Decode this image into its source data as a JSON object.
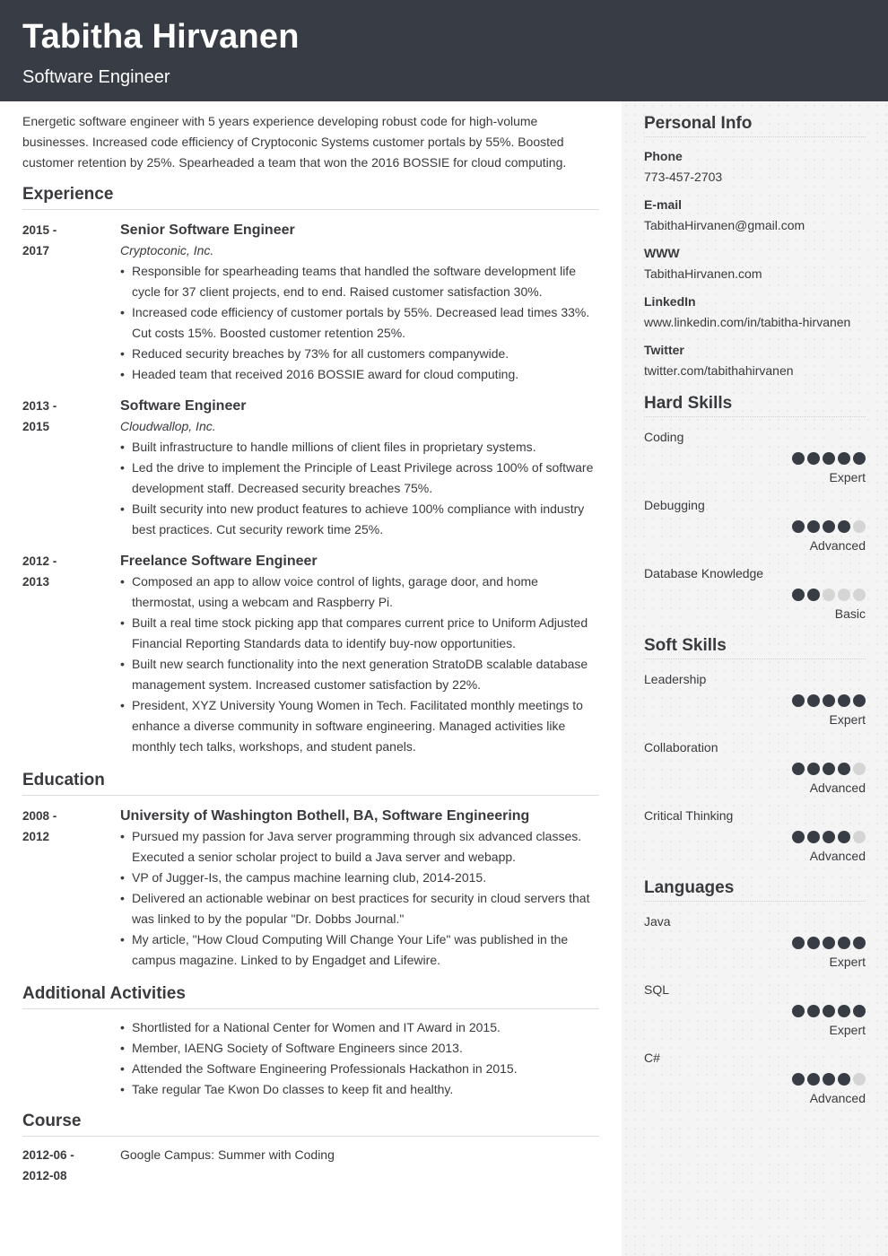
{
  "header": {
    "name": "Tabitha Hirvanen",
    "role": "Software Engineer"
  },
  "summary": "Energetic software engineer with 5 years experience developing robust code for high-volume businesses. Increased code efficiency of Cryptoconic Systems customer portals by 55%. Boosted customer retention by 25%. Spearheaded a team that won the 2016 BOSSIE for cloud computing.",
  "experience": {
    "heading": "Experience",
    "entries": [
      {
        "date_start": "2015 -",
        "date_end": "2017",
        "title": "Senior Software Engineer",
        "company": "Cryptoconic, Inc.",
        "bullets": [
          "Responsible for spearheading teams that handled the software development life cycle for 37 client projects, end to end. Raised customer satisfaction 30%.",
          "Increased code efficiency of customer portals by 55%. Decreased lead times 33%. Cut costs 15%. Boosted customer retention 25%.",
          "Reduced security breaches by 73% for all customers companywide.",
          "Headed team that received 2016 BOSSIE award for cloud computing."
        ]
      },
      {
        "date_start": "2013 -",
        "date_end": "2015",
        "title": "Software Engineer",
        "company": "Cloudwallop, Inc.",
        "bullets": [
          "Built infrastructure to handle millions of client files in proprietary systems.",
          "Led the drive to implement the Principle of Least Privilege across 100% of software development staff. Decreased security breaches 75%.",
          "Built security into new product features to achieve 100% compliance with industry best practices. Cut security rework time 25%."
        ]
      },
      {
        "date_start": "2012 -",
        "date_end": "2013",
        "title": "Freelance Software Engineer",
        "bullets": [
          "Composed an app to allow voice control of lights, garage door, and home thermostat, using a webcam and Raspberry Pi.",
          "Built a real time stock picking app that compares current price to Uniform Adjusted Financial Reporting Standards data to identify buy-now opportunities.",
          "Built new search functionality into the next generation StratoDB scalable database management system. Increased customer satisfaction by 22%.",
          "President, XYZ University Young Women in Tech. Facilitated monthly meetings to enhance a diverse community in software engineering. Managed activities like monthly tech talks, workshops, and student panels."
        ]
      }
    ]
  },
  "education": {
    "heading": "Education",
    "entries": [
      {
        "date_start": "2008 -",
        "date_end": "2012",
        "title": "University of Washington Bothell, BA, Software Engineering",
        "bullets": [
          "Pursued my passion for Java server programming through six advanced classes. Executed a senior scholar project to build a Java server and webapp.",
          "VP of Jugger-Is, the campus machine learning club, 2014-2015.",
          "Delivered an actionable webinar on best practices for security in cloud servers that was linked to by the popular \"Dr. Dobbs Journal.\"",
          "My article, \"How Cloud Computing Will Change Your Life\" was published in the campus magazine. Linked to by Engadget and Lifewire."
        ]
      }
    ]
  },
  "activities": {
    "heading": "Additional Activities",
    "bullets": [
      "Shortlisted for a National Center for Women and IT Award in 2015.",
      "Member, IAENG Society of Software Engineers since 2013.",
      "Attended the Software Engineering Professionals Hackathon in 2015.",
      "Take regular Tae Kwon Do classes to keep fit and healthy."
    ]
  },
  "course": {
    "heading": "Course",
    "entries": [
      {
        "date_start": "2012-06 -",
        "date_end": "2012-08",
        "title": "Google Campus: Summer with Coding"
      }
    ]
  },
  "personal_info": {
    "heading": "Personal Info",
    "items": [
      {
        "label": "Phone",
        "value": "773-457-2703"
      },
      {
        "label": "E-mail",
        "value": "TabithaHirvanen@gmail.com"
      },
      {
        "label": "WWW",
        "value": "TabithaHirvanen.com"
      },
      {
        "label": "LinkedIn",
        "value": "www.linkedin.com/in/tabitha-hirvanen"
      },
      {
        "label": "Twitter",
        "value": "twitter.com/tabithahirvanen"
      }
    ]
  },
  "hard_skills": {
    "heading": "Hard Skills",
    "items": [
      {
        "name": "Coding",
        "rating": 5,
        "max": 5,
        "level": "Expert"
      },
      {
        "name": "Debugging",
        "rating": 4,
        "max": 5,
        "level": "Advanced"
      },
      {
        "name": "Database Knowledge",
        "rating": 2,
        "max": 5,
        "level": "Basic"
      }
    ]
  },
  "soft_skills": {
    "heading": "Soft Skills",
    "items": [
      {
        "name": "Leadership",
        "rating": 5,
        "max": 5,
        "level": "Expert"
      },
      {
        "name": "Collaboration",
        "rating": 4,
        "max": 5,
        "level": "Advanced"
      },
      {
        "name": "Critical Thinking",
        "rating": 4,
        "max": 5,
        "level": "Advanced"
      }
    ]
  },
  "languages": {
    "heading": "Languages",
    "items": [
      {
        "name": "Java",
        "rating": 5,
        "max": 5,
        "level": "Expert"
      },
      {
        "name": "SQL",
        "rating": 5,
        "max": 5,
        "level": "Expert"
      },
      {
        "name": "C#",
        "rating": 4,
        "max": 5,
        "level": "Advanced"
      }
    ]
  },
  "colors": {
    "header_bg": "#383c45",
    "text": "#393a3d",
    "sidebar_bg": "#f4f4f4",
    "dot_filled": "#383c45",
    "dot_empty": "#d5d5d5"
  }
}
